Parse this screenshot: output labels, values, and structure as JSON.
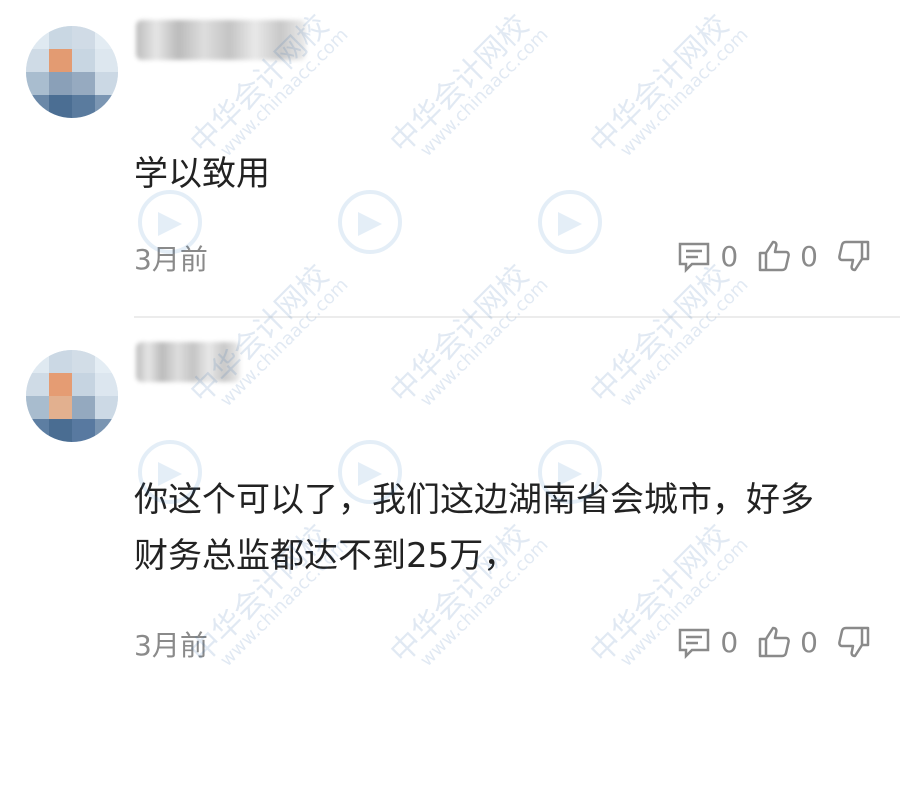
{
  "comments": [
    {
      "text": "学以致用",
      "time": "3月前",
      "reply_count": "0",
      "like_count": "0"
    },
    {
      "text_line1": "你这个可以了，我们这边湖南省会城市，好多",
      "text_line2": "财务总监都达不到25万，",
      "time": "3月前",
      "reply_count": "0",
      "like_count": "0"
    }
  ],
  "watermark": {
    "cn": "中华会计网校",
    "url": "www.chinaacc.com"
  },
  "icons": {
    "reply": "comment-icon",
    "like": "thumbs-up-icon",
    "dislike": "thumbs-down-icon"
  }
}
